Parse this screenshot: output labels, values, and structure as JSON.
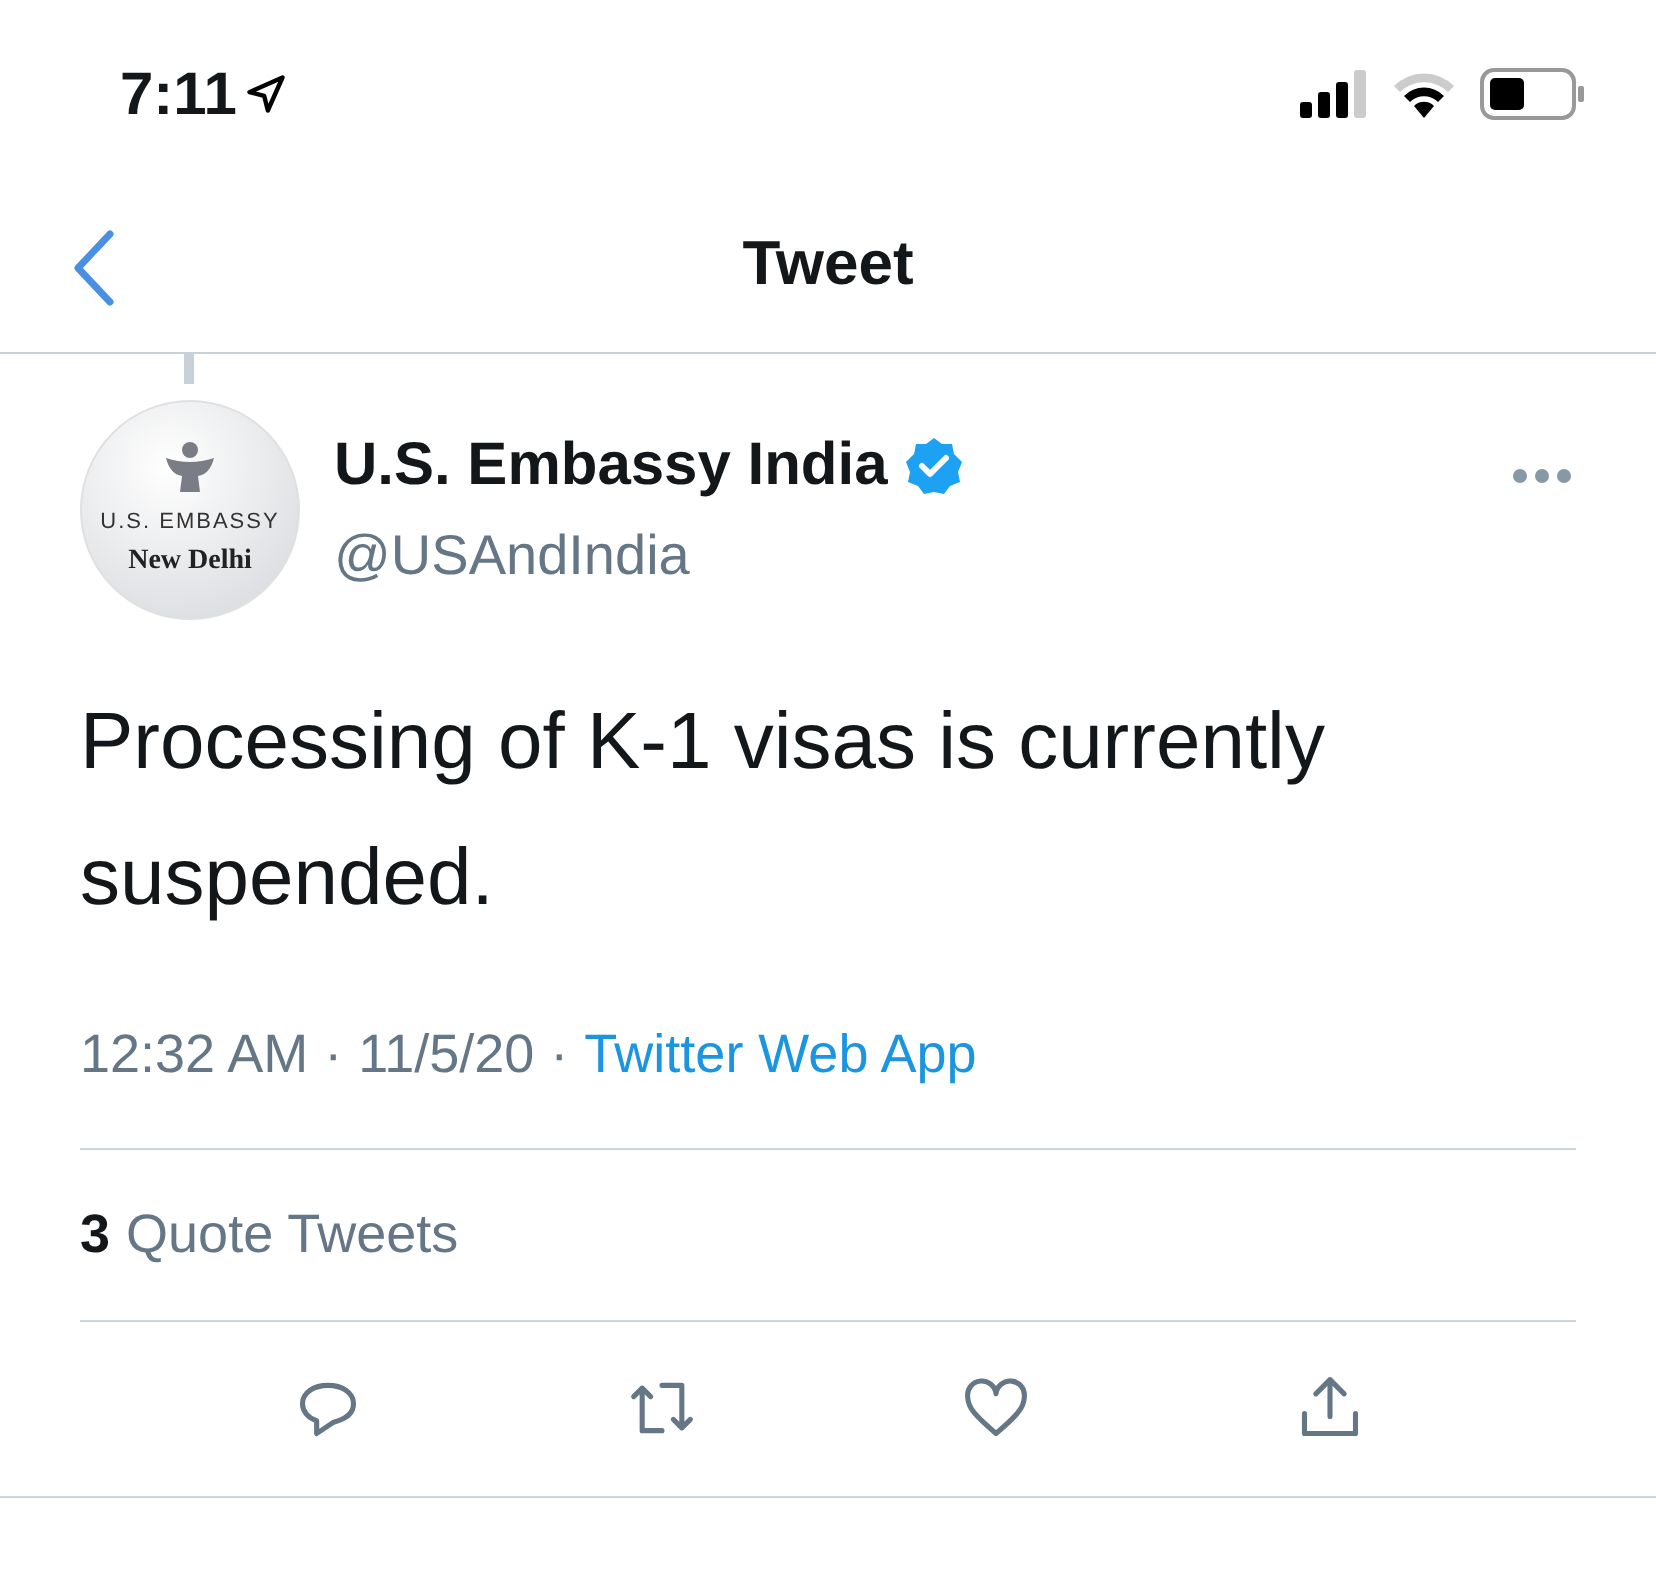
{
  "status_bar": {
    "time": "7:11"
  },
  "nav": {
    "title": "Tweet"
  },
  "tweet": {
    "avatar": {
      "line_1": "U.S. EMBASSY",
      "line_2": "New Delhi"
    },
    "name": "U.S. Embassy India",
    "verified": true,
    "handle": "@USAndIndia",
    "text": "Processing of K-1 visas is currently suspended.",
    "time": "12:32 AM",
    "date": "11/5/20",
    "source": "Twitter Web App",
    "separator": "·"
  },
  "stats": [
    {
      "count": "3",
      "label": "Quote Tweets"
    }
  ]
}
